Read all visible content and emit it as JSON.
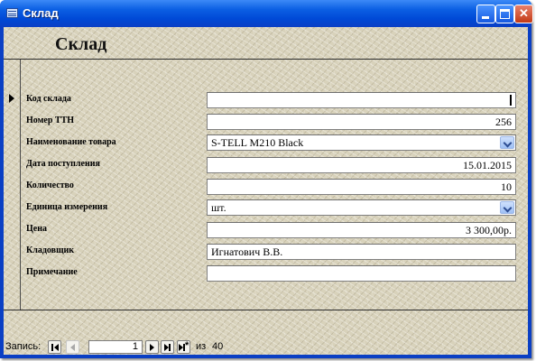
{
  "window": {
    "title": "Склад"
  },
  "form": {
    "header_title": "Склад",
    "fields": {
      "warehouse_code": {
        "label": "Код склада",
        "value": ""
      },
      "ttn_number": {
        "label": "Номер ТТН",
        "value": "256"
      },
      "product_name": {
        "label": "Наименование товара",
        "value": "S-TELL M210 Black"
      },
      "receipt_date": {
        "label": "Дата поступления",
        "value": "15.01.2015"
      },
      "quantity": {
        "label": "Количество",
        "value": "10"
      },
      "unit": {
        "label": "Единица измерения",
        "value": "шт."
      },
      "price": {
        "label": "Цена",
        "value": "3 300,00р."
      },
      "storekeeper": {
        "label": "Кладовщик",
        "value": "Игнатович В.В."
      },
      "note": {
        "label": "Примечание",
        "value": ""
      }
    }
  },
  "navigation": {
    "label": "Запись:",
    "current_record": "1",
    "of_label": "из",
    "total_records": "40"
  },
  "icons": [
    "app-icon",
    "minimize-icon",
    "maximize-icon",
    "close-icon",
    "record-pointer-icon",
    "dropdown-arrow-icon",
    "first-record-icon",
    "prev-record-icon",
    "next-record-icon",
    "last-record-icon",
    "new-record-icon"
  ],
  "colors": {
    "title_bar": "#0b5fe3",
    "form_background": "#d8d2bb",
    "close_button": "#c23a15"
  }
}
